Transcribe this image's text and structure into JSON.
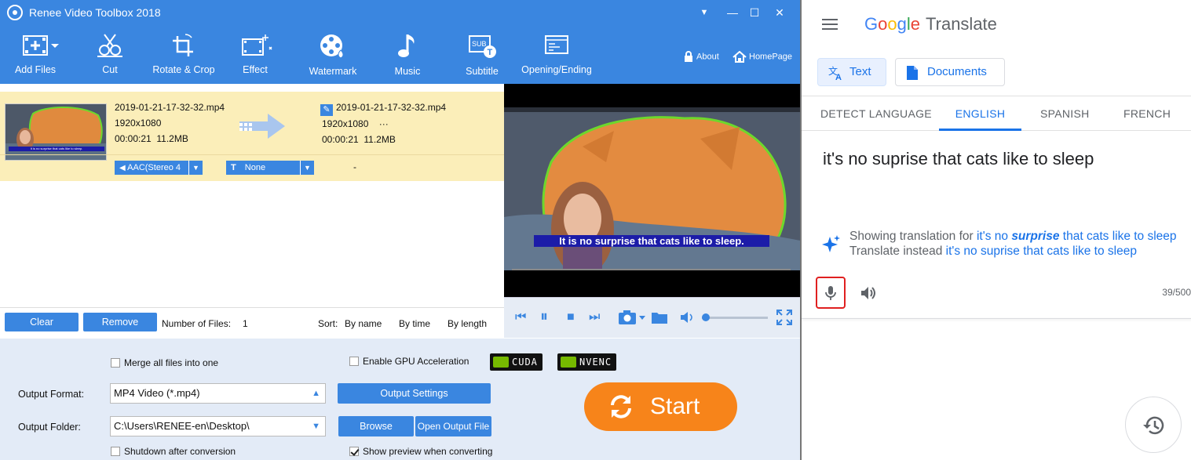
{
  "renee": {
    "title": "Renee Video Toolbox 2018",
    "window_controls": {
      "menu": "▼",
      "minimize": "—",
      "maximize": "☐",
      "close": "✕"
    },
    "toolbar": {
      "add_files": "Add Files",
      "cut": "Cut",
      "rotate_crop": "Rotate & Crop",
      "effect": "Effect",
      "watermark": "Watermark",
      "music": "Music",
      "subtitle": "Subtitle",
      "opening_ending": "Opening/Ending",
      "about": "About",
      "homepage": "HomePage"
    },
    "file": {
      "thumb_caption": "It is no surprise that cats like to sleep.",
      "source": {
        "name": "2019-01-21-17-32-32.mp4",
        "resolution": "1920x1080",
        "duration": "00:00:21",
        "size": "11.2MB"
      },
      "output": {
        "name": "2019-01-21-17-32-32.mp4",
        "resolution": "1920x1080",
        "extra": "···",
        "duration": "00:00:21",
        "size": "11.2MB"
      },
      "audio_track": "AAC(Stereo 4",
      "subtitle_track": "None",
      "dash": "-"
    },
    "preview": {
      "caption": "It is no surprise that cats like to sleep."
    },
    "list_controls": {
      "clear": "Clear",
      "remove": "Remove",
      "file_count_label": "Number of Files:",
      "file_count": "1",
      "sort_label": "Sort:",
      "sort_name": "By name",
      "sort_time": "By time",
      "sort_length": "By length"
    },
    "settings": {
      "merge": "Merge all files into one",
      "gpu": "Enable GPU Acceleration",
      "cuda": "CUDA",
      "nvenc": "NVENC",
      "output_format_label": "Output Format:",
      "output_format": "MP4 Video (*.mp4)",
      "output_settings": "Output Settings",
      "output_folder_label": "Output Folder:",
      "output_folder": "C:\\Users\\RENEE-en\\Desktop\\",
      "browse": "Browse",
      "open_output": "Open Output File",
      "shutdown": "Shutdown after conversion",
      "show_preview": "Show preview when converting",
      "start": "Start"
    },
    "colors": {
      "accent": "#3a86e0",
      "start": "#f7841a",
      "row_highlight": "#fbeeb9"
    }
  },
  "translate": {
    "logo_word": "Google",
    "product": "Translate",
    "modes": {
      "text": "Text",
      "documents": "Documents"
    },
    "tabs": [
      "DETECT LANGUAGE",
      "ENGLISH",
      "SPANISH",
      "FRENCH"
    ],
    "source_text": "it's no suprise that cats like to sleep",
    "suggestion": {
      "prefix": "Showing translation for",
      "link_a": "it's no",
      "link_em": "surprise",
      "link_b": "that cats like to sleep",
      "instead_prefix": "Translate instead",
      "instead_link": "it's no suprise that cats like to sleep"
    },
    "char_count": "39/500",
    "colors": {
      "blue": "#1a73e8",
      "mic_highlight": "#e02020"
    }
  }
}
